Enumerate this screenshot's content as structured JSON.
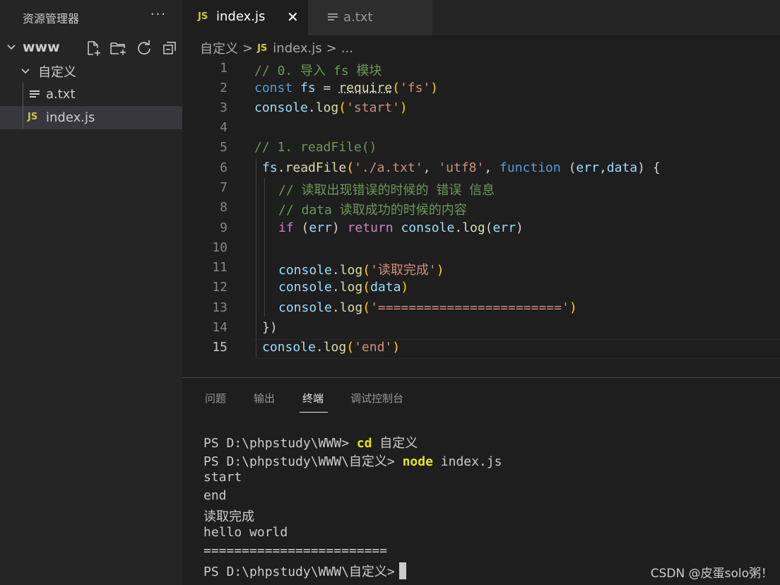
{
  "sidebar": {
    "title": "资源管理器",
    "more": "···",
    "root_folder": "www",
    "folder": "自定义",
    "files": [
      {
        "name": "a.txt",
        "icon": "text-file-icon"
      },
      {
        "name": "index.js",
        "icon": "JS"
      }
    ]
  },
  "tabs": [
    {
      "label": "index.js",
      "icon": "JS",
      "active": true,
      "close": "✕"
    },
    {
      "label": "a.txt",
      "active": false
    }
  ],
  "breadcrumb": {
    "folder": "自定义",
    "sep": ">",
    "file_icon": "JS",
    "file": "index.js",
    "tail": "..."
  },
  "editor": {
    "line_numbers": [
      "1",
      "2",
      "3",
      "4",
      "5",
      "6",
      "7",
      "8",
      "9",
      "10",
      "11",
      "12",
      "13",
      "14",
      "15"
    ],
    "current_line": "15",
    "lines": {
      "l1": "// 0. 导入 fs 模块",
      "l2_kw": "const",
      "l2_var": "fs",
      "l2_eq": " = ",
      "l2_fn": "require",
      "l2_open": "(",
      "l2_str": "'fs'",
      "l2_close": ")",
      "l3_obj": "console",
      "l3_dot": ".",
      "l3_fn": "log",
      "l3_open": "(",
      "l3_str": "'start'",
      "l3_close": ")",
      "l5": "// 1. readFile()",
      "l6_obj": "fs",
      "l6_dot": ".",
      "l6_fn": "readFile",
      "l6_open": "(",
      "l6_str1": "'./a.txt'",
      "l6_c1": ", ",
      "l6_str2": "'utf8'",
      "l6_c2": ", ",
      "l6_kw": "function",
      "l6_paren": " (",
      "l6_p1": "err",
      "l6_comma": ",",
      "l6_p2": "data",
      "l6_close": ") {",
      "l7": "// 读取出现错误的时候的 错误 信息",
      "l8": "// data 读取成功的时候的内容",
      "l9_if": "if",
      "l9_open": " (",
      "l9_var": "err",
      "l9_close": ") ",
      "l9_ret": "return",
      "l9_sp": " ",
      "l9_obj": "console",
      "l9_dot": ".",
      "l9_fn": "log",
      "l9_o2": "(",
      "l9_arg": "err",
      "l9_c2": ")",
      "l11_obj": "console",
      "l11_dot": ".",
      "l11_fn": "log",
      "l11_open": "(",
      "l11_str": "'读取完成'",
      "l11_close": ")",
      "l12_obj": "console",
      "l12_dot": ".",
      "l12_fn": "log",
      "l12_open": "(",
      "l12_arg": "data",
      "l12_close": ")",
      "l13_obj": "console",
      "l13_dot": ".",
      "l13_fn": "log",
      "l13_open": "(",
      "l13_str": "'========================'",
      "l13_close": ")",
      "l14": "})",
      "l15_obj": "console",
      "l15_dot": ".",
      "l15_fn": "log",
      "l15_open": "(",
      "l15_str": "'end'",
      "l15_close": ")"
    }
  },
  "panel": {
    "tabs": [
      "问题",
      "输出",
      "终端",
      "调试控制台"
    ],
    "active_tab": "终端",
    "terminal": {
      "line1_prompt": "PS D:\\phpstudy\\WWW> ",
      "line1_cmd": "cd",
      "line1_arg": " 自定义",
      "line2_prompt": "PS D:\\phpstudy\\WWW\\自定义> ",
      "line2_cmd": "node",
      "line2_arg": " index.js",
      "out1": "start",
      "out2": "end",
      "out3": "读取完成",
      "out4": "hello world",
      "out5": "========================",
      "line_last": "PS D:\\phpstudy\\WWW\\自定义>"
    }
  },
  "watermark": "CSDN @皮蛋solo粥！"
}
